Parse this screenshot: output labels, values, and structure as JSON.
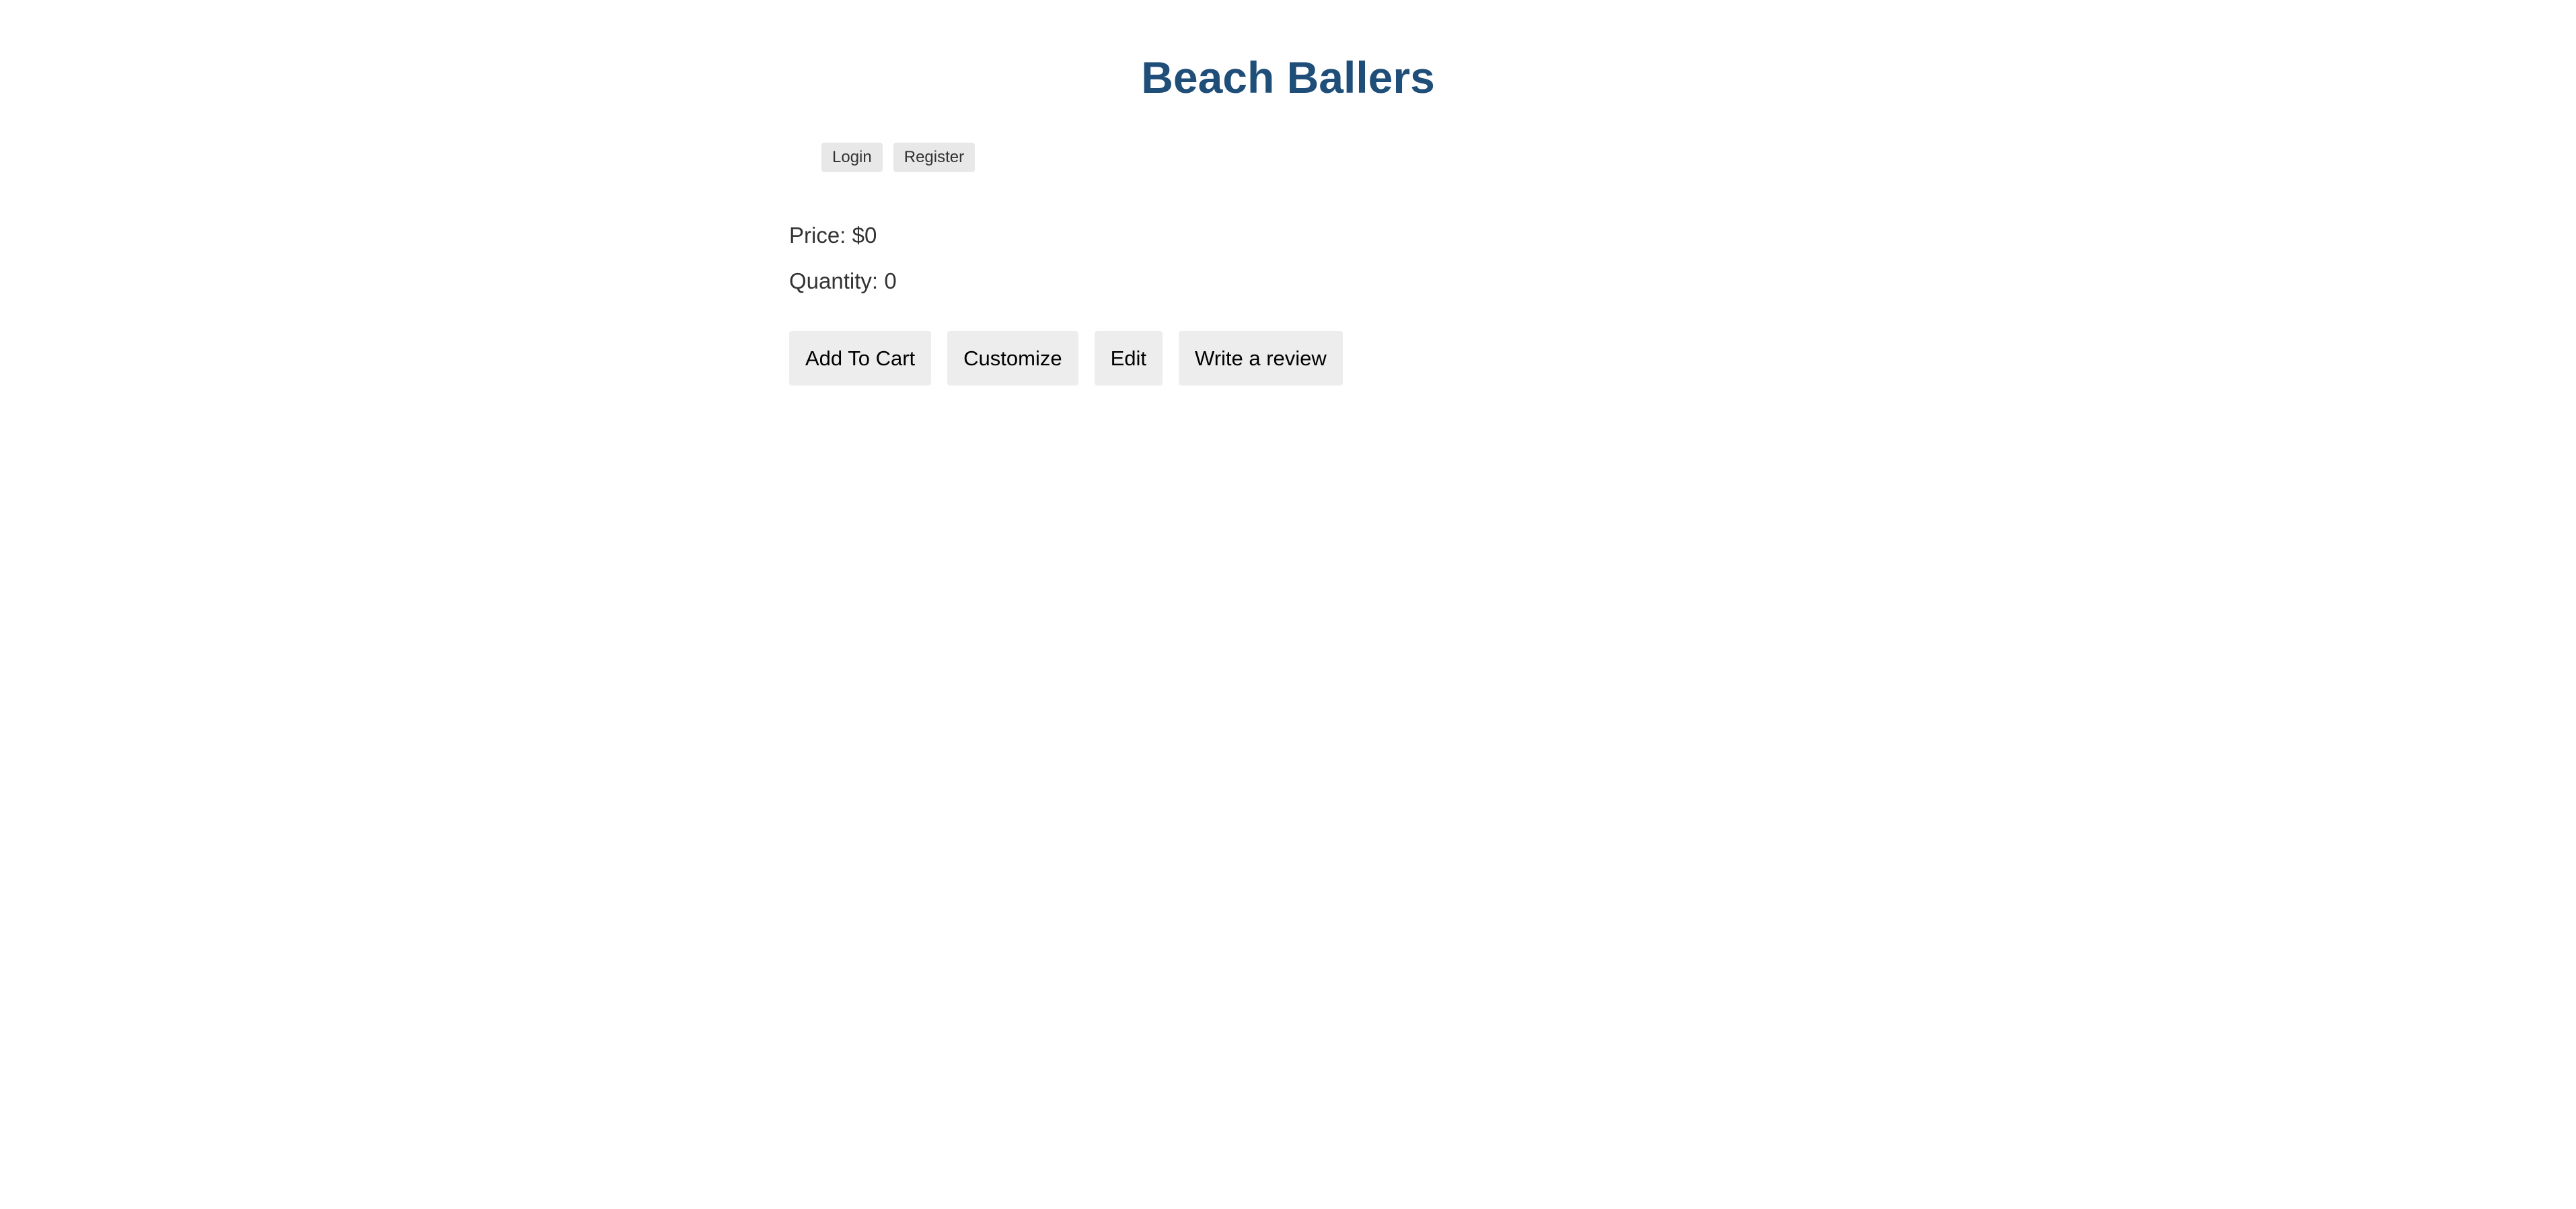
{
  "header": {
    "title": "Beach Ballers"
  },
  "auth_nav": {
    "login_label": "Login",
    "register_label": "Register"
  },
  "product": {
    "price_label": "Price:",
    "price_value": "$0",
    "quantity_label": "Quantity:",
    "quantity_value": "0"
  },
  "actions": {
    "add_to_cart_label": "Add To Cart",
    "customize_label": "Customize",
    "edit_label": "Edit",
    "write_review_label": "Write a review"
  },
  "colors": {
    "title": "#1f4e79",
    "text": "#333333",
    "button_bg": "#ededed",
    "page_bg": "#ffffff"
  }
}
